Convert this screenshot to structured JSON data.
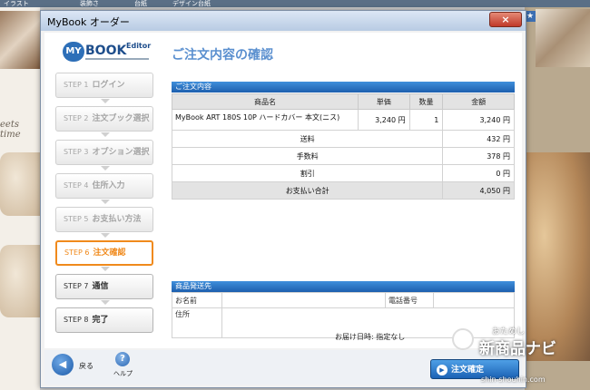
{
  "background": {
    "tabs": [
      "イラスト",
      "装飾さ",
      "台紙",
      "デザイン台紙"
    ],
    "left_text": "eets time"
  },
  "window": {
    "title": "MyBook オーダー",
    "close_label": "×"
  },
  "logo": {
    "my": "MY",
    "book": "BOOK",
    "editor": "Editor"
  },
  "steps": [
    {
      "num": "STEP 1",
      "label": "ログイン",
      "state": "disabled"
    },
    {
      "num": "STEP 2",
      "label": "注文ブック選択",
      "state": "disabled"
    },
    {
      "num": "STEP 3",
      "label": "オプション選択",
      "state": "disabled"
    },
    {
      "num": "STEP 4",
      "label": "住所入力",
      "state": "disabled"
    },
    {
      "num": "STEP 5",
      "label": "お支払い方法",
      "state": "disabled"
    },
    {
      "num": "STEP 6",
      "label": "注文確認",
      "state": "active"
    },
    {
      "num": "STEP 7",
      "label": "通信",
      "state": "upcoming"
    },
    {
      "num": "STEP 8",
      "label": "完了",
      "state": "upcoming"
    }
  ],
  "page_title": "ご注文内容の確認",
  "order": {
    "header": "ご注文内容",
    "columns": [
      "商品名",
      "単価",
      "数量",
      "金額"
    ],
    "item": {
      "name": "MyBook ART 180S 10P ハードカバー 本文(ニス)",
      "unit_price": "3,240 円",
      "qty": "1",
      "amount": "3,240 円"
    },
    "summary": [
      {
        "label": "送料",
        "value": "432 円"
      },
      {
        "label": "手数料",
        "value": "378 円"
      },
      {
        "label": "割引",
        "value": "0 円"
      },
      {
        "label": "お支払い合計",
        "value": "4,050 円"
      }
    ]
  },
  "shipping": {
    "header": "商品発送先",
    "name_label": "お名前",
    "phone_label": "電話番号",
    "address_label": "住所",
    "delivery": "お届け日時: 指定なし"
  },
  "footer": {
    "back_label": "戻る",
    "help_label": "ヘルプ",
    "confirm_label": "注文確定"
  },
  "watermark": {
    "small": "おためし",
    "big": "新商品ナビ",
    "url": "shin-shouhin.com"
  },
  "colors": {
    "accent": "#f08a1c",
    "header_blue": "#1d5fae",
    "price_red": "#e12b2b"
  }
}
